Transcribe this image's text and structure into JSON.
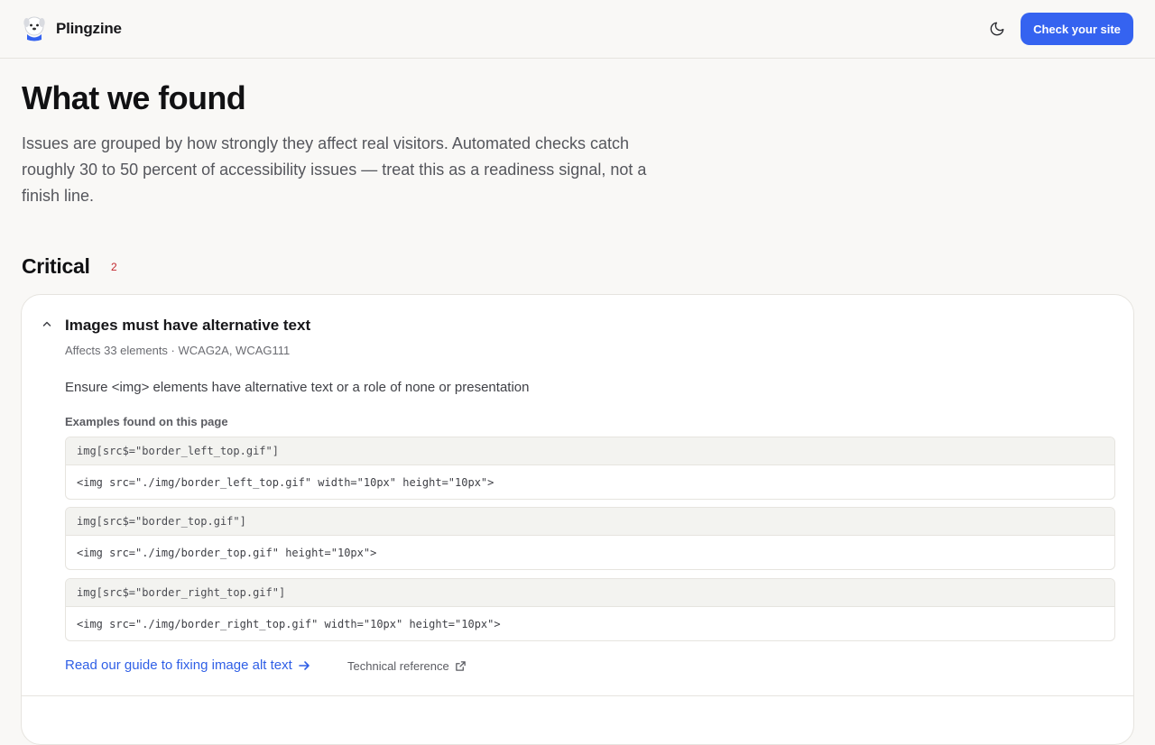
{
  "header": {
    "brand_name": "Plingzine",
    "cta_label": "Check your site",
    "icons": {
      "logo": "dog-mascot-logo",
      "theme": "moon-icon"
    }
  },
  "intro": {
    "title": "What we found",
    "description": "Issues are grouped by how strongly they affect real visitors. Automated checks catch roughly 30 to 50 percent of accessibility issues — treat this as a readiness signal, not a finish line."
  },
  "section": {
    "title": "Critical",
    "count": "2"
  },
  "issue": {
    "title": "Images must have alternative text",
    "meta": "Affects 33 elements · WCAG2A, WCAG111",
    "description": "Ensure <img> elements have alternative text or a role of none or presentation",
    "examples_label": "Examples found on this page",
    "examples": [
      {
        "selector": "img[src$=\"border_left_top.gif\"]",
        "html": "<img src=\"./img/border_left_top.gif\" width=\"10px\" height=\"10px\">"
      },
      {
        "selector": "img[src$=\"border_top.gif\"]",
        "html": "<img src=\"./img/border_top.gif\" height=\"10px\">"
      },
      {
        "selector": "img[src$=\"border_right_top.gif\"]",
        "html": "<img src=\"./img/border_right_top.gif\" width=\"10px\" height=\"10px\">"
      }
    ],
    "guide_link": "Read our guide to fixing image alt text",
    "tech_ref": "Technical reference"
  },
  "colors": {
    "accent": "#3563f0",
    "link": "#2f5fe6",
    "critical": "#c2272d",
    "background": "#f9f8f6"
  }
}
